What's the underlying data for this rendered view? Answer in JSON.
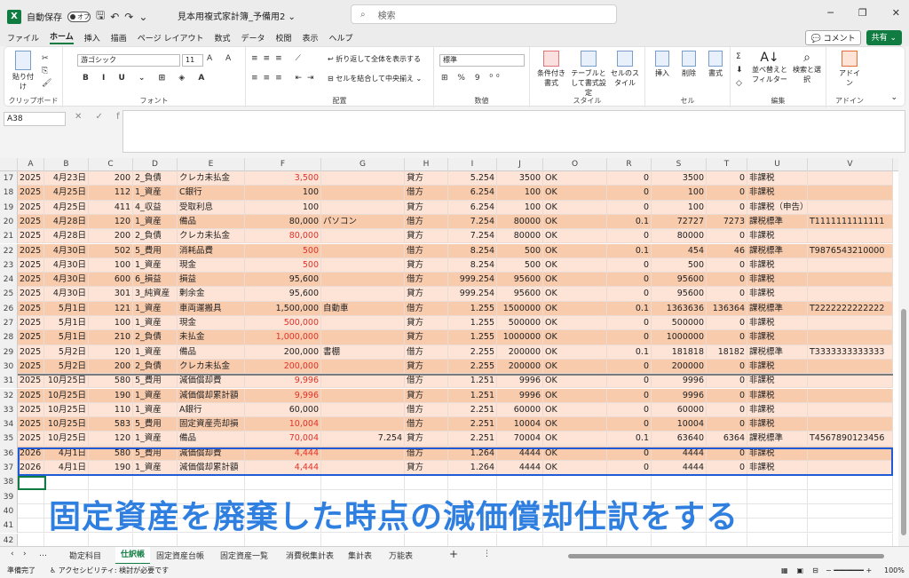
{
  "titlebar": {
    "autosave_label": "自動保存",
    "autosave_state": "オフ",
    "doc_title": "見本用複式家計簿_予備用2",
    "search_placeholder": "検索"
  },
  "menu": [
    "ファイル",
    "ホーム",
    "挿入",
    "描画",
    "ページ レイアウト",
    "数式",
    "データ",
    "校閲",
    "表示",
    "ヘルプ"
  ],
  "menu_active_index": 1,
  "comment_label": "コメント",
  "share_label": "共有",
  "ribbon": {
    "paste": "貼り付け",
    "clipboard": "クリップボード",
    "font_name": "游ゴシック",
    "font_size": "11",
    "font": "フォント",
    "wrap_text": "折り返して全体を表示する",
    "merge_center": "セルを結合して中央揃え",
    "alignment": "配置",
    "number_format": "標準",
    "number": "数値",
    "conditional": "条件付き書式",
    "as_table": "テーブルとして書式設定",
    "cell_styles": "セルのスタイル",
    "styles": "スタイル",
    "insert": "挿入",
    "delete": "削除",
    "format": "書式",
    "cells": "セル",
    "sort_filter": "並べ替えとフィルター",
    "find_select": "検索と選択",
    "editing": "編集",
    "addin": "アドイン",
    "addins": "アドイン"
  },
  "namebox": "A38",
  "columns": [
    "A",
    "B",
    "C",
    "D",
    "E",
    "F",
    "G",
    "H",
    "I",
    "J",
    "O",
    "R",
    "S",
    "T",
    "U",
    "V"
  ],
  "rows": [
    {
      "n": "17",
      "c": [
        "2025",
        "4月23日",
        "200",
        "2_負債",
        "クレカ未払金",
        "3,500",
        "",
        "貸方",
        "5.254",
        "3500",
        "OK",
        "0",
        "3500",
        "0",
        "非課税",
        ""
      ],
      "red": true,
      "bg": 1
    },
    {
      "n": "18",
      "c": [
        "2025",
        "4月25日",
        "112",
        "1_資産",
        "C銀行",
        "100",
        "",
        "借方",
        "6.254",
        "100",
        "OK",
        "0",
        "100",
        "0",
        "非課税",
        ""
      ],
      "red": false,
      "bg": 2
    },
    {
      "n": "19",
      "c": [
        "2025",
        "4月25日",
        "411",
        "4_収益",
        "受取利息",
        "100",
        "",
        "貸方",
        "6.254",
        "100",
        "OK",
        "0",
        "100",
        "0",
        "非課税（申告）",
        ""
      ],
      "red": false,
      "bg": 1
    },
    {
      "n": "20",
      "c": [
        "2025",
        "4月28日",
        "120",
        "1_資産",
        "備品",
        "80,000",
        "パソコン",
        "借方",
        "7.254",
        "80000",
        "OK",
        "0.1",
        "72727",
        "7273",
        "課税標準",
        "T1111111111111"
      ],
      "red": false,
      "bg": 2
    },
    {
      "n": "21",
      "c": [
        "2025",
        "4月28日",
        "200",
        "2_負債",
        "クレカ未払金",
        "80,000",
        "",
        "貸方",
        "7.254",
        "80000",
        "OK",
        "0",
        "80000",
        "0",
        "非課税",
        ""
      ],
      "red": true,
      "bg": 1
    },
    {
      "n": "22",
      "c": [
        "2025",
        "4月30日",
        "502",
        "5_費用",
        "消耗品費",
        "500",
        "",
        "借方",
        "8.254",
        "500",
        "OK",
        "0.1",
        "454",
        "46",
        "課税標準",
        "T9876543210000"
      ],
      "red": true,
      "bg": 2
    },
    {
      "n": "23",
      "c": [
        "2025",
        "4月30日",
        "100",
        "1_資産",
        "現金",
        "500",
        "",
        "貸方",
        "8.254",
        "500",
        "OK",
        "0",
        "500",
        "0",
        "非課税",
        ""
      ],
      "red": true,
      "bg": 1
    },
    {
      "n": "24",
      "c": [
        "2025",
        "4月30日",
        "600",
        "6_損益",
        "損益",
        "95,600",
        "",
        "借方",
        "999.254",
        "95600",
        "OK",
        "0",
        "95600",
        "0",
        "非課税",
        ""
      ],
      "red": false,
      "bg": 2
    },
    {
      "n": "25",
      "c": [
        "2025",
        "4月30日",
        "301",
        "3_純資産",
        "剰余金",
        "95,600",
        "",
        "貸方",
        "999.254",
        "95600",
        "OK",
        "0",
        "95600",
        "0",
        "非課税",
        ""
      ],
      "red": false,
      "bg": 1
    },
    {
      "n": "26",
      "c": [
        "2025",
        "5月1日",
        "121",
        "1_資産",
        "車両運搬具",
        "1,500,000",
        "自動車",
        "借方",
        "1.255",
        "1500000",
        "OK",
        "0.1",
        "1363636",
        "136364",
        "課税標準",
        "T2222222222222"
      ],
      "red": false,
      "bg": 2
    },
    {
      "n": "27",
      "c": [
        "2025",
        "5月1日",
        "100",
        "1_資産",
        "現金",
        "500,000",
        "",
        "貸方",
        "1.255",
        "500000",
        "OK",
        "0",
        "500000",
        "0",
        "非課税",
        ""
      ],
      "red": true,
      "bg": 1
    },
    {
      "n": "28",
      "c": [
        "2025",
        "5月1日",
        "210",
        "2_負債",
        "未払金",
        "1,000,000",
        "",
        "貸方",
        "1.255",
        "1000000",
        "OK",
        "0",
        "1000000",
        "0",
        "非課税",
        ""
      ],
      "red": true,
      "bg": 2
    },
    {
      "n": "29",
      "c": [
        "2025",
        "5月2日",
        "120",
        "1_資産",
        "備品",
        "200,000",
        "書棚",
        "借方",
        "2.255",
        "200000",
        "OK",
        "0.1",
        "181818",
        "18182",
        "課税標準",
        "T3333333333333"
      ],
      "red": false,
      "bg": 1
    },
    {
      "n": "30",
      "c": [
        "2025",
        "5月2日",
        "200",
        "2_負債",
        "クレカ未払金",
        "200,000",
        "",
        "貸方",
        "2.255",
        "200000",
        "OK",
        "0",
        "200000",
        "0",
        "非課税",
        ""
      ],
      "red": true,
      "bg": 2
    },
    {
      "n": "31",
      "c": [
        "2025",
        "10月25日",
        "580",
        "5_費用",
        "減価償却費",
        "9,996",
        "",
        "借方",
        "1.251",
        "9996",
        "OK",
        "0",
        "9996",
        "0",
        "非課税",
        ""
      ],
      "red": true,
      "bg": 1
    },
    {
      "n": "32",
      "c": [
        "2025",
        "10月25日",
        "190",
        "1_資産",
        "減価償却累計額",
        "9,996",
        "",
        "貸方",
        "1.251",
        "9996",
        "OK",
        "0",
        "9996",
        "0",
        "非課税",
        ""
      ],
      "red": true,
      "bg": 2
    },
    {
      "n": "33",
      "c": [
        "2025",
        "10月25日",
        "110",
        "1_資産",
        "A銀行",
        "60,000",
        "",
        "借方",
        "2.251",
        "60000",
        "OK",
        "0",
        "60000",
        "0",
        "非課税",
        ""
      ],
      "red": false,
      "bg": 1
    },
    {
      "n": "34",
      "c": [
        "2025",
        "10月25日",
        "583",
        "5_費用",
        "固定資産売却損",
        "10,004",
        "",
        "借方",
        "2.251",
        "10004",
        "OK",
        "0",
        "10004",
        "0",
        "非課税",
        ""
      ],
      "red": true,
      "bg": 2
    },
    {
      "n": "35",
      "c": [
        "2025",
        "10月25日",
        "120",
        "1_資産",
        "備品",
        "70,004",
        "7.254",
        "貸方",
        "2.251",
        "70004",
        "OK",
        "0.1",
        "63640",
        "6364",
        "課税標準",
        "T4567890123456"
      ],
      "red": true,
      "bg": 1
    },
    {
      "n": "36",
      "c": [
        "2026",
        "4月1日",
        "580",
        "5_費用",
        "減価償却費",
        "4,444",
        "",
        "借方",
        "1.264",
        "4444",
        "OK",
        "0",
        "4444",
        "0",
        "非課税",
        ""
      ],
      "red": true,
      "bg": 2
    },
    {
      "n": "37",
      "c": [
        "2026",
        "4月1日",
        "190",
        "1_資産",
        "減価償却累計額",
        "4,444",
        "",
        "貸方",
        "1.264",
        "4444",
        "OK",
        "0",
        "4444",
        "0",
        "非課税",
        ""
      ],
      "red": true,
      "bg": 1
    },
    {
      "n": "38",
      "c": [],
      "red": false,
      "bg": 0
    },
    {
      "n": "39",
      "c": [],
      "red": false,
      "bg": 0
    },
    {
      "n": "40",
      "c": [],
      "red": false,
      "bg": 0
    },
    {
      "n": "41",
      "c": [],
      "red": false,
      "bg": 0
    },
    {
      "n": "42",
      "c": [],
      "red": false,
      "bg": 0
    }
  ],
  "overlay_text": "固定資産を廃棄した時点の減価償却仕訳をする",
  "sheets": [
    "勘定科目",
    "仕訳帳",
    "固定資産台帳",
    "固定資産一覧",
    "消費税集計表",
    "集計表",
    "万能表"
  ],
  "active_sheet_index": 1,
  "status": {
    "ready": "準備完了",
    "accessibility": "アクセシビリティ: 検討が必要です",
    "zoom": "100%"
  }
}
